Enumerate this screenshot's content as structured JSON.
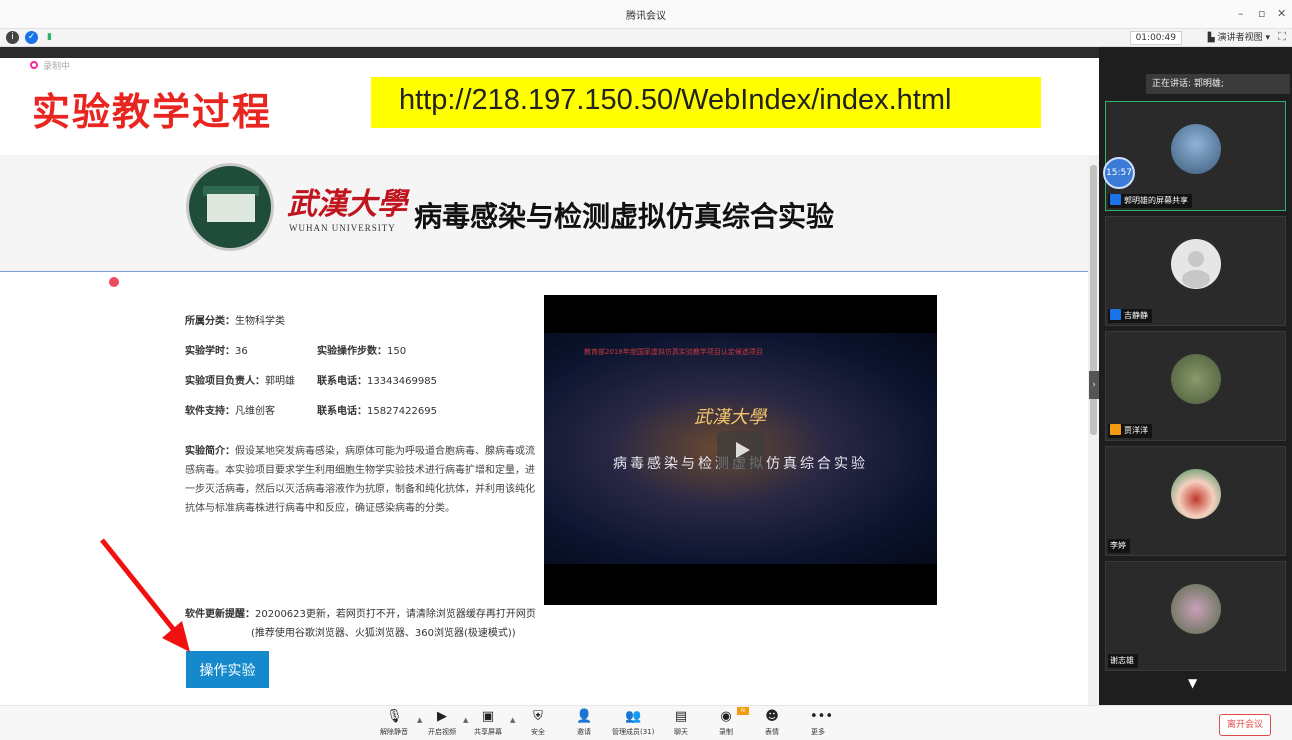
{
  "window": {
    "title": "腾讯会议"
  },
  "toolbar": {
    "timer": "01:00:49",
    "speaker_view": "演讲者视图"
  },
  "screen": {
    "recording": "录制中",
    "heading": "实验教学过程",
    "url": "http://218.197.150.50/WebIndex/index.html",
    "site": {
      "logo_cn": "武漢大學",
      "logo_en": "WUHAN UNIVERSITY",
      "title": "病毒感染与检测虚拟仿真综合实验"
    },
    "info": {
      "category_label": "所属分类：",
      "category": "生物科学类",
      "hours_label": "实验学时：",
      "hours": "36",
      "steps_label": "实验操作步数：",
      "steps": "150",
      "leader_label": "实验项目负责人：",
      "leader": "郭明雄",
      "phone1_label": "联系电话：",
      "phone1": "13343469985",
      "support_label": "软件支持：",
      "support": "凡维创客",
      "phone2_label": "联系电话：",
      "phone2": "15827422695",
      "intro_label": "实验简介：",
      "intro": "假设某地突发病毒感染，病原体可能为呼吸道合胞病毒、腺病毒或流感病毒。本实验项目要求学生利用细胞生物学实验技术进行病毒扩增和定量，进一步灭活病毒，然后以灭活病毒溶液作为抗原，制备和纯化抗体，并利用该纯化抗体与标准病毒株进行病毒中和反应，确证感染病毒的分类。",
      "update_label": "软件更新提醒：",
      "update": "20200623更新，若网页打不开，请清除浏览器缓存再打开网页",
      "update2": "(推荐使用谷歌浏览器、火狐浏览器、360浏览器(极速模式))"
    },
    "video": {
      "top_text": "教育部2018年度国家虚拟仿真实验教学项目认定候选项目",
      "logo": "武漢大學",
      "subtitle": "病毒感染与检测虚拟仿真综合实验"
    },
    "operate_button": "操作实验"
  },
  "panel": {
    "speaking": "正在讲话: 郭明雄;",
    "clock": "15:57",
    "participants": [
      {
        "name": "郭明雄的屏幕共享"
      },
      {
        "name": "吉静静"
      },
      {
        "name": "贾洋洋"
      },
      {
        "name": "李婷"
      },
      {
        "name": "谢志雄"
      }
    ]
  },
  "bottombar": {
    "unmute": "解除静音",
    "video": "开启视频",
    "share": "共享屏幕",
    "security": "安全",
    "invite": "邀请",
    "members": "管理成员(31)",
    "chat": "聊天",
    "record": "录制",
    "reactions": "表情",
    "more": "更多",
    "leave": "离开会议"
  },
  "colors": {
    "accent": "#1689cc",
    "heading_red": "#e8251f",
    "url_bg": "#ffff00",
    "leave_red": "#e24b4b"
  }
}
